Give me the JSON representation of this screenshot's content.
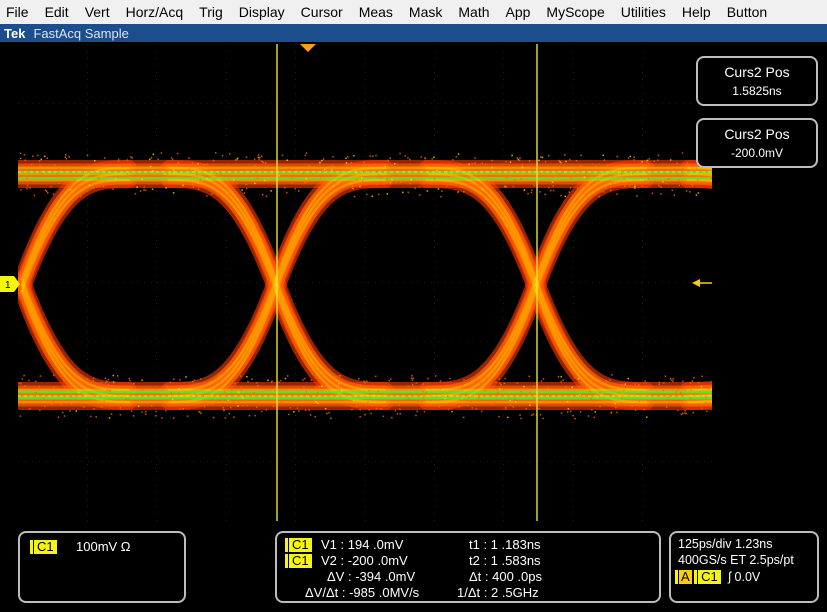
{
  "menu": [
    "File",
    "Edit",
    "Vert",
    "Horz/Acq",
    "Trig",
    "Display",
    "Cursor",
    "Meas",
    "Mask",
    "Math",
    "App",
    "MyScope",
    "Utilities",
    "Help",
    "Button"
  ],
  "titlebar": {
    "brand": "Tek",
    "mode": "FastAcq Sample"
  },
  "scope": {
    "channel_marker": "1",
    "colors": {
      "trace_hot": "#ff6a00",
      "trace_mid": "#ff3a00",
      "trace_peak": "#3cff3c",
      "trace_warm": "#ffe600",
      "cursor": "#e8e23a",
      "grid": "#3a3a3a"
    }
  },
  "cursor_boxes": [
    {
      "title": "Curs2 Pos",
      "value": "1.5825ns"
    },
    {
      "title": "Curs2 Pos",
      "value": "-200.0mV"
    }
  ],
  "channel_box": {
    "tag": "C1",
    "scale": "100mV Ω"
  },
  "cursor_readout": {
    "v1_tag": "C1",
    "v1": "V1 :  194 .0mV",
    "v2_tag": "C1",
    "v2": "V2 : -200 .0mV",
    "dv": "ΔV : -394 .0mV",
    "dvdt": "ΔV/Δt : -985 .0MV/s",
    "t1": "t1 :     1 .183ns",
    "t2": "t2 :     1 .583ns",
    "dt": "Δt : 400 .0ps",
    "inv_dt": "1/Δt :     2 .5GHz"
  },
  "horiz_box": {
    "line1": "125ps/div  1.23ns",
    "line2": "400GS/s ET 2.5ps/pt",
    "trig_tag_a": "A",
    "trig_tag_c": "C1",
    "trig_level": "ʃ 0.0V"
  }
}
